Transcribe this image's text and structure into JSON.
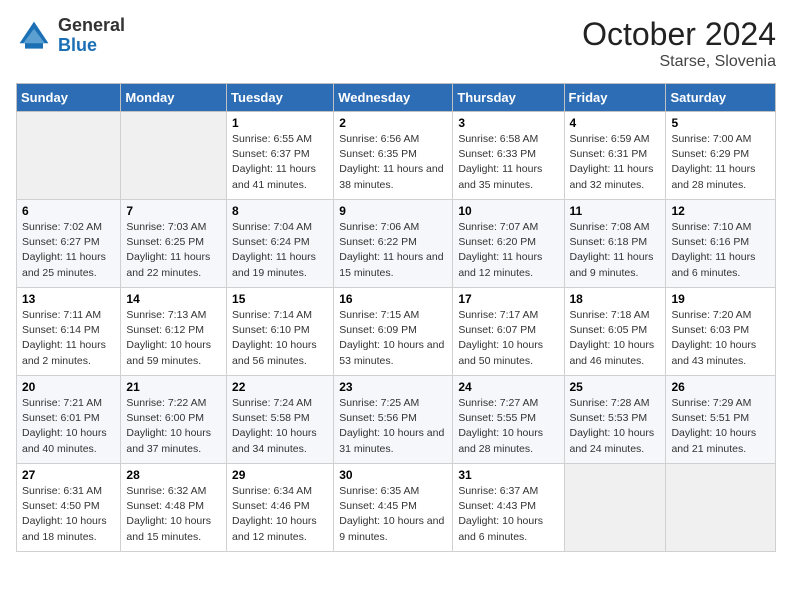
{
  "header": {
    "logo_general": "General",
    "logo_blue": "Blue",
    "month_title": "October 2024",
    "location": "Starse, Slovenia"
  },
  "days_of_week": [
    "Sunday",
    "Monday",
    "Tuesday",
    "Wednesday",
    "Thursday",
    "Friday",
    "Saturday"
  ],
  "weeks": [
    [
      {
        "day": "",
        "info": ""
      },
      {
        "day": "",
        "info": ""
      },
      {
        "day": "1",
        "info": "Sunrise: 6:55 AM\nSunset: 6:37 PM\nDaylight: 11 hours and 41 minutes."
      },
      {
        "day": "2",
        "info": "Sunrise: 6:56 AM\nSunset: 6:35 PM\nDaylight: 11 hours and 38 minutes."
      },
      {
        "day": "3",
        "info": "Sunrise: 6:58 AM\nSunset: 6:33 PM\nDaylight: 11 hours and 35 minutes."
      },
      {
        "day": "4",
        "info": "Sunrise: 6:59 AM\nSunset: 6:31 PM\nDaylight: 11 hours and 32 minutes."
      },
      {
        "day": "5",
        "info": "Sunrise: 7:00 AM\nSunset: 6:29 PM\nDaylight: 11 hours and 28 minutes."
      }
    ],
    [
      {
        "day": "6",
        "info": "Sunrise: 7:02 AM\nSunset: 6:27 PM\nDaylight: 11 hours and 25 minutes."
      },
      {
        "day": "7",
        "info": "Sunrise: 7:03 AM\nSunset: 6:25 PM\nDaylight: 11 hours and 22 minutes."
      },
      {
        "day": "8",
        "info": "Sunrise: 7:04 AM\nSunset: 6:24 PM\nDaylight: 11 hours and 19 minutes."
      },
      {
        "day": "9",
        "info": "Sunrise: 7:06 AM\nSunset: 6:22 PM\nDaylight: 11 hours and 15 minutes."
      },
      {
        "day": "10",
        "info": "Sunrise: 7:07 AM\nSunset: 6:20 PM\nDaylight: 11 hours and 12 minutes."
      },
      {
        "day": "11",
        "info": "Sunrise: 7:08 AM\nSunset: 6:18 PM\nDaylight: 11 hours and 9 minutes."
      },
      {
        "day": "12",
        "info": "Sunrise: 7:10 AM\nSunset: 6:16 PM\nDaylight: 11 hours and 6 minutes."
      }
    ],
    [
      {
        "day": "13",
        "info": "Sunrise: 7:11 AM\nSunset: 6:14 PM\nDaylight: 11 hours and 2 minutes."
      },
      {
        "day": "14",
        "info": "Sunrise: 7:13 AM\nSunset: 6:12 PM\nDaylight: 10 hours and 59 minutes."
      },
      {
        "day": "15",
        "info": "Sunrise: 7:14 AM\nSunset: 6:10 PM\nDaylight: 10 hours and 56 minutes."
      },
      {
        "day": "16",
        "info": "Sunrise: 7:15 AM\nSunset: 6:09 PM\nDaylight: 10 hours and 53 minutes."
      },
      {
        "day": "17",
        "info": "Sunrise: 7:17 AM\nSunset: 6:07 PM\nDaylight: 10 hours and 50 minutes."
      },
      {
        "day": "18",
        "info": "Sunrise: 7:18 AM\nSunset: 6:05 PM\nDaylight: 10 hours and 46 minutes."
      },
      {
        "day": "19",
        "info": "Sunrise: 7:20 AM\nSunset: 6:03 PM\nDaylight: 10 hours and 43 minutes."
      }
    ],
    [
      {
        "day": "20",
        "info": "Sunrise: 7:21 AM\nSunset: 6:01 PM\nDaylight: 10 hours and 40 minutes."
      },
      {
        "day": "21",
        "info": "Sunrise: 7:22 AM\nSunset: 6:00 PM\nDaylight: 10 hours and 37 minutes."
      },
      {
        "day": "22",
        "info": "Sunrise: 7:24 AM\nSunset: 5:58 PM\nDaylight: 10 hours and 34 minutes."
      },
      {
        "day": "23",
        "info": "Sunrise: 7:25 AM\nSunset: 5:56 PM\nDaylight: 10 hours and 31 minutes."
      },
      {
        "day": "24",
        "info": "Sunrise: 7:27 AM\nSunset: 5:55 PM\nDaylight: 10 hours and 28 minutes."
      },
      {
        "day": "25",
        "info": "Sunrise: 7:28 AM\nSunset: 5:53 PM\nDaylight: 10 hours and 24 minutes."
      },
      {
        "day": "26",
        "info": "Sunrise: 7:29 AM\nSunset: 5:51 PM\nDaylight: 10 hours and 21 minutes."
      }
    ],
    [
      {
        "day": "27",
        "info": "Sunrise: 6:31 AM\nSunset: 4:50 PM\nDaylight: 10 hours and 18 minutes."
      },
      {
        "day": "28",
        "info": "Sunrise: 6:32 AM\nSunset: 4:48 PM\nDaylight: 10 hours and 15 minutes."
      },
      {
        "day": "29",
        "info": "Sunrise: 6:34 AM\nSunset: 4:46 PM\nDaylight: 10 hours and 12 minutes."
      },
      {
        "day": "30",
        "info": "Sunrise: 6:35 AM\nSunset: 4:45 PM\nDaylight: 10 hours and 9 minutes."
      },
      {
        "day": "31",
        "info": "Sunrise: 6:37 AM\nSunset: 4:43 PM\nDaylight: 10 hours and 6 minutes."
      },
      {
        "day": "",
        "info": ""
      },
      {
        "day": "",
        "info": ""
      }
    ]
  ]
}
